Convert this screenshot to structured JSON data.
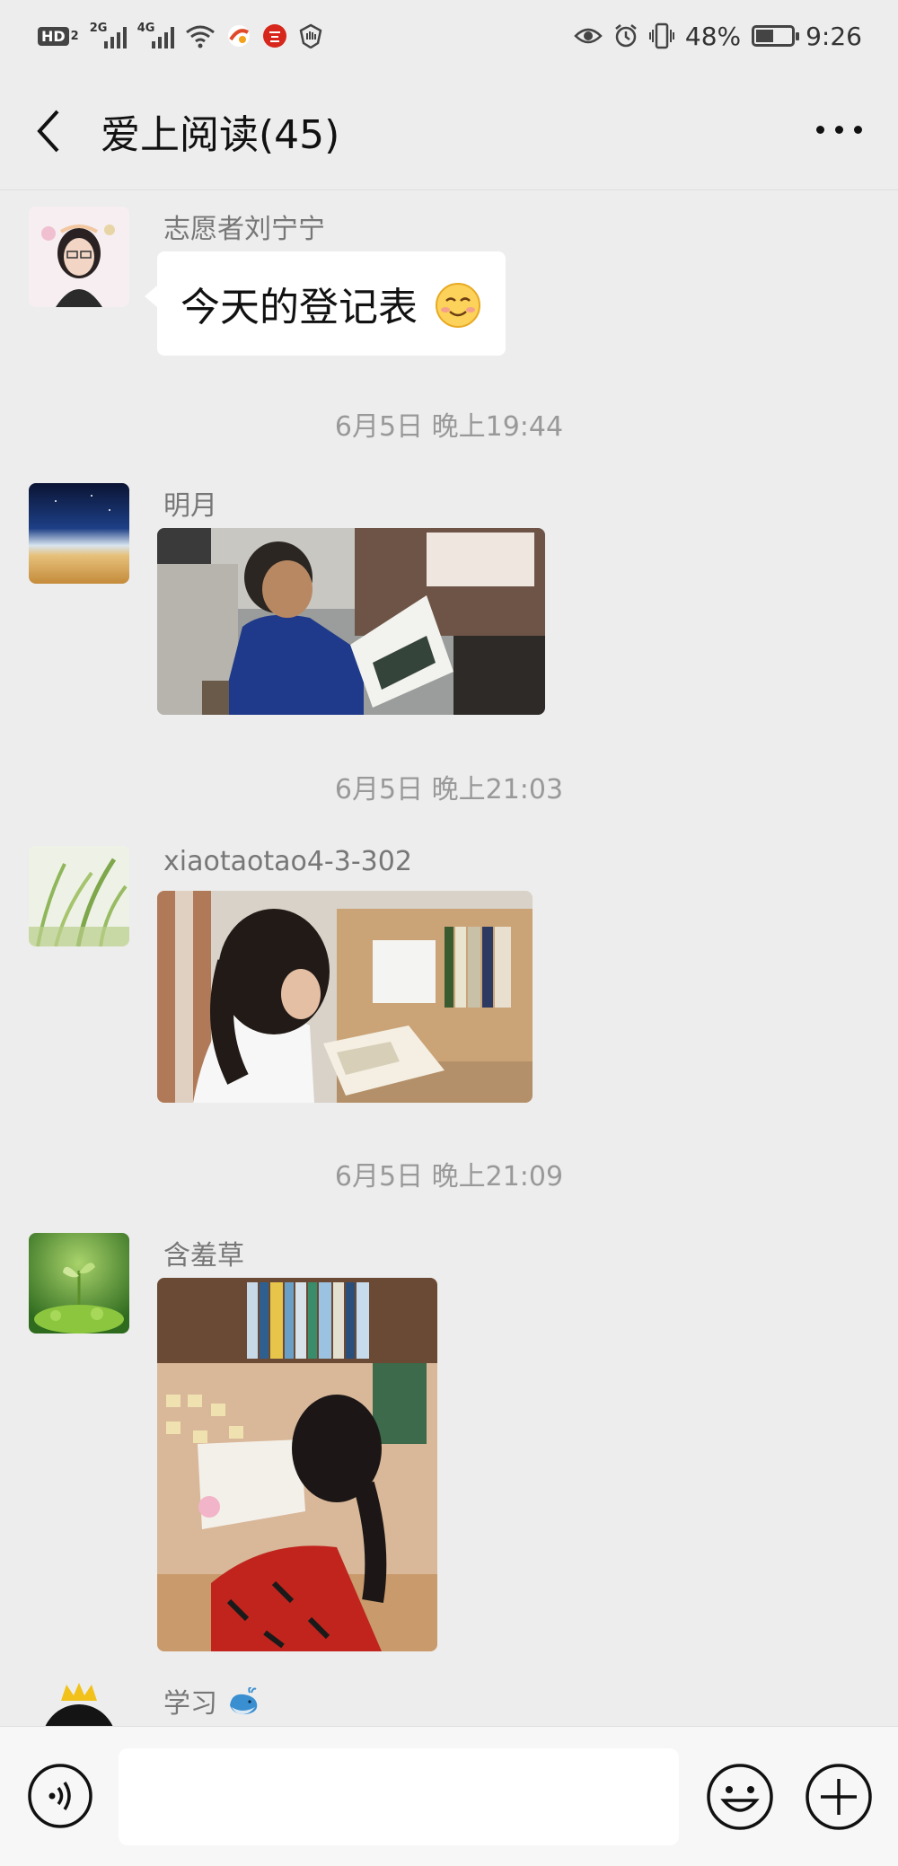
{
  "status_bar": {
    "network_badge": "HD",
    "network_badge_sub": "2",
    "signal1_label": "2G",
    "signal2_label": "4G",
    "battery_percent": "48%",
    "battery_level": 0.48,
    "time": "9:26",
    "icons": [
      "hd-icon",
      "signal-icon",
      "wifi-icon",
      "app-notification-icon",
      "app-notification-icon",
      "shield-icon",
      "eye-icon",
      "alarm-icon",
      "vibrate-icon",
      "battery-icon"
    ]
  },
  "header": {
    "title": "爱上阅读(45)",
    "back_icon": "chevron-left-icon",
    "more_icon": "more-dots-icon"
  },
  "messages": [
    {
      "sender": "志愿者刘宁宁",
      "type": "text",
      "text": "今天的登记表",
      "emoji": "smiling-face"
    },
    {
      "type": "timestamp",
      "text": "6月5日 晚上19:44"
    },
    {
      "sender": "明月",
      "type": "image",
      "image": "boy-reading-photo"
    },
    {
      "type": "timestamp",
      "text": "6月5日 晚上21:03"
    },
    {
      "sender": "xiaotaotao4-3-302",
      "type": "image",
      "image": "girl-reading-at-bookshelf-photo"
    },
    {
      "type": "timestamp",
      "text": "6月5日 晚上21:09"
    },
    {
      "sender": "含羞草",
      "type": "image",
      "image": "girl-reading-at-desk-photo"
    },
    {
      "sender": "学习",
      "sender_emoji": "whale-emoji",
      "type": "partial"
    }
  ],
  "input_bar": {
    "voice_icon": "voice-icon",
    "emoji_icon": "emoji-icon",
    "plus_icon": "plus-icon",
    "text_value": ""
  },
  "colors": {
    "chat_background": "#ededed",
    "bubble": "#ffffff",
    "timestamp_text": "#999999",
    "sender_text": "#777777"
  }
}
